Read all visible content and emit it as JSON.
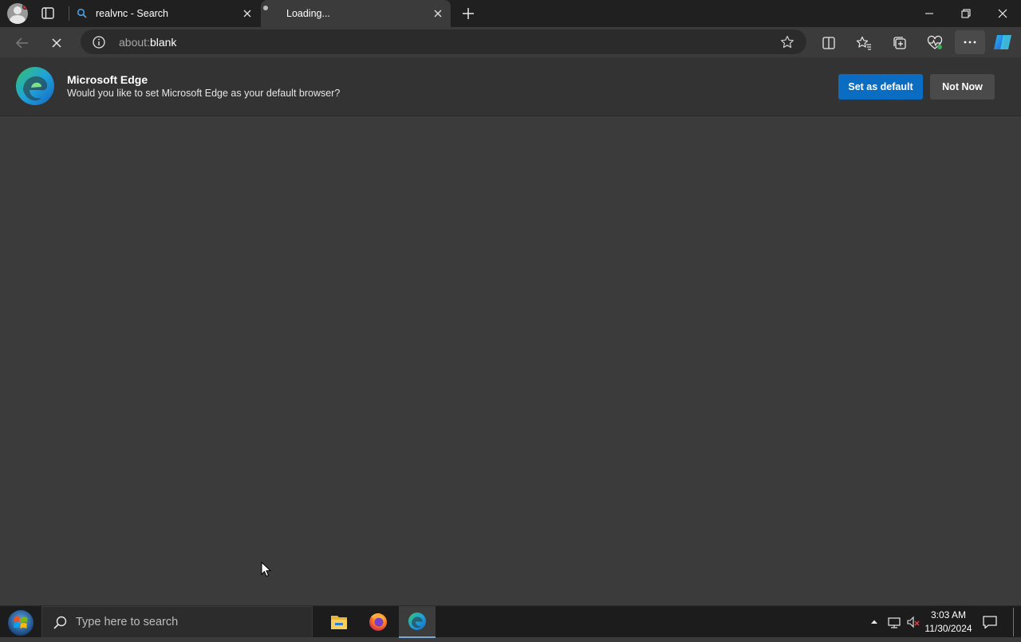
{
  "tabs": [
    {
      "title": "realvnc - Search",
      "icon": "search-icon"
    },
    {
      "title": "Loading...",
      "icon": "loading-icon"
    }
  ],
  "address": {
    "prefix": "about:",
    "page": "blank"
  },
  "infobar": {
    "title": "Microsoft Edge",
    "message": "Would you like to set Microsoft Edge as your default browser?",
    "primary_label": "Set as default",
    "secondary_label": "Not Now"
  },
  "taskbar": {
    "search_placeholder": "Type here to search",
    "time": "3:03 AM",
    "date": "11/30/2024",
    "apps": [
      "file-explorer-icon",
      "firefox-icon",
      "edge-icon"
    ]
  },
  "colors": {
    "accent": "#0a6dc2",
    "content_bg": "#3b3b3b",
    "titlebar_bg": "#202020"
  }
}
